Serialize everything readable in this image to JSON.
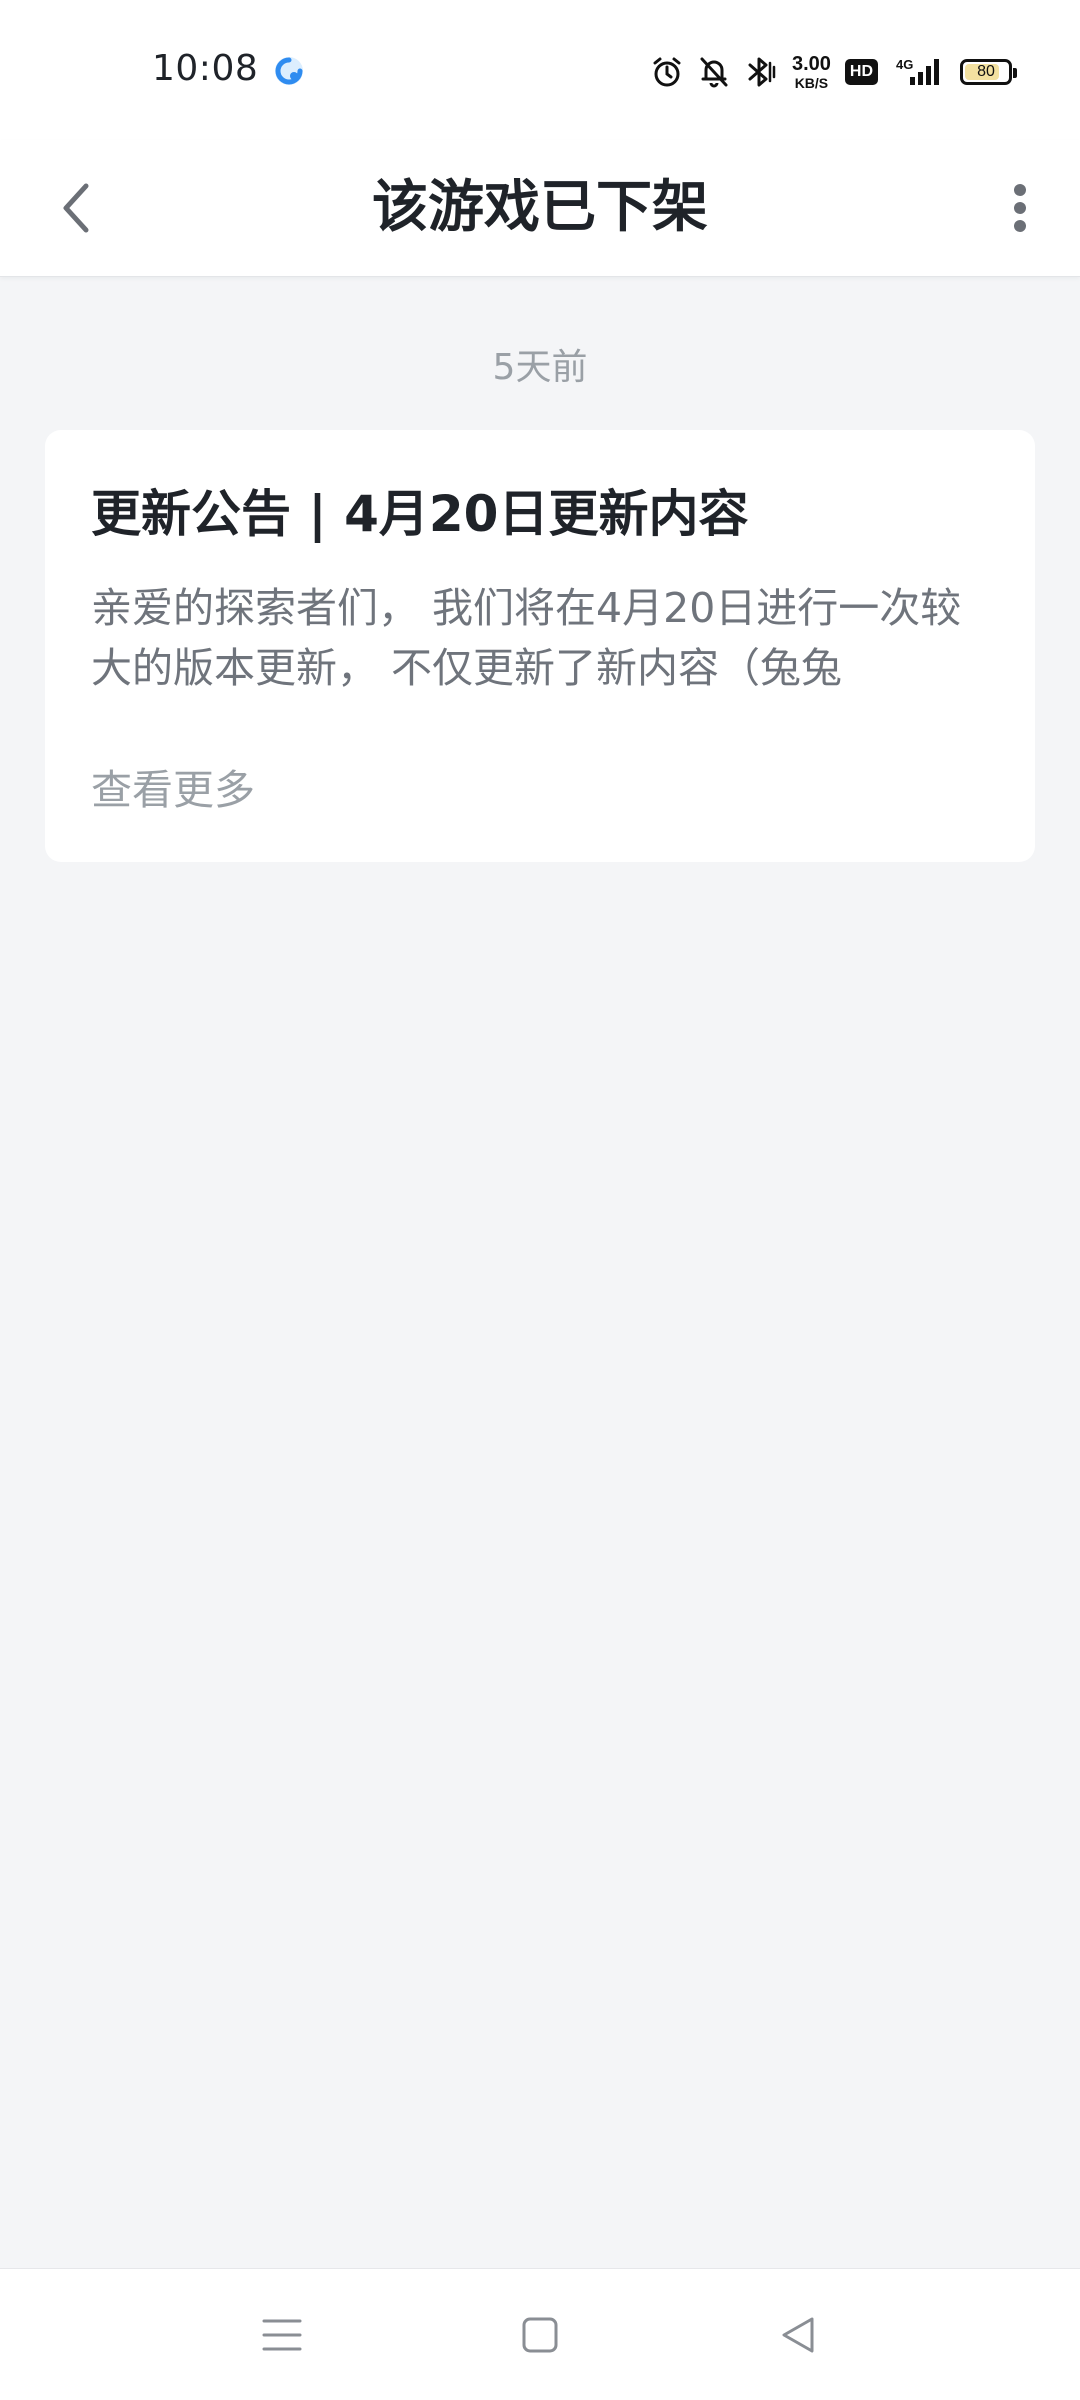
{
  "status_bar": {
    "time": "10:08",
    "net_speed_value": "3.00",
    "net_speed_unit": "KB/S",
    "hd_label": "HD",
    "network_type": "4G",
    "battery_level": "80",
    "battery_percent": 80,
    "icons": [
      "app-notification-icon",
      "alarm-icon",
      "mute-icon",
      "bluetooth-icon",
      "signal-icon",
      "battery-icon"
    ]
  },
  "header": {
    "title": "该游戏已下架",
    "back_icon": "chevron-left-icon",
    "more_icon": "more-vertical-icon"
  },
  "feed": {
    "timestamp": "5天前",
    "card": {
      "title": "更新公告 | 4月20日更新内容",
      "body": "亲爱的探索者们， 我们将在4月20日进行一次较大的版本更新， 不仅更新了新内容（兔兔",
      "more_label": "查看更多"
    }
  },
  "nav_bar": {
    "icons": [
      "menu-icon",
      "home-icon",
      "back-icon"
    ]
  },
  "colors": {
    "background": "#f4f5f7",
    "surface": "#ffffff",
    "title_text": "#1f2329",
    "body_text": "#6f747c",
    "muted_text": "#9aa0a6",
    "battery_fill": "#f3e1a0"
  }
}
